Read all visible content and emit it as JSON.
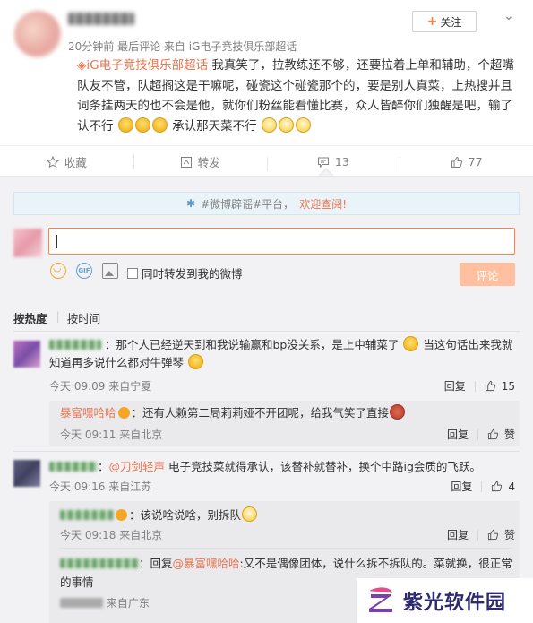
{
  "post": {
    "author_name": "",
    "meta_time": "20分钟前 最后评论",
    "meta_from_prefix": "来自",
    "meta_source": "iG电子竞技俱乐部超话",
    "follow_label": "关注",
    "topic": "iG电子竞技俱乐部超话",
    "text": "我真笑了，拉教练还不够，还要拉着上单和辅助，个超嘴队友不管，队超搁这是干嘛呢，碰瓷这个碰瓷那个的，要是别人真菜，上热搜并且词条挂两天的也不会是他，就你们粉丝能看懂比赛，众人皆醉你们独醒是吧，输了认不行",
    "text_tail": "承认那天菜不行"
  },
  "actions": {
    "favorite_label": "收藏",
    "repost_label": "转发",
    "comment_count": "13",
    "like_count": "77"
  },
  "notice": {
    "prefix": "#微博辟谣#平台，",
    "link": "欢迎查阅!"
  },
  "composer": {
    "checkbox_label": "同时转发到我的微博",
    "submit_label": "评论"
  },
  "sort": {
    "hot": "按热度",
    "time": "按时间"
  },
  "comments": [
    {
      "text": "：那个人已经逆天到和我说输赢和bp没关系，是上中辅菜了",
      "text2": "当这句话出来我就知道再多说什么都对牛弹琴",
      "time": "今天 09:09 来自宁夏",
      "reply": "回复",
      "likes": "15",
      "replies": [
        {
          "name": "暴富嘿哈哈",
          "text": "：还有人赖第二局莉莉娅不开团呢，给我气笑了直接",
          "time": "今天 09:11 来自北京",
          "reply": "回复",
          "like": "赞"
        }
      ]
    },
    {
      "mention": "@刀剑轻声",
      "text": " 电子竞技菜就得承认，该替补就替补，换个中路ig会质的飞跃。",
      "time": "今天 09:16 来自江苏",
      "reply": "回复",
      "likes": "4",
      "replies": [
        {
          "text": "：该说啥说啥，别拆队",
          "time": "今天 09:18 来自北京",
          "reply": "回复",
          "like": "赞"
        },
        {
          "text_prefix": "：回复",
          "mention": "@暴富嘿哈哈",
          "text": ":又不是偶像团体，说什么拆不拆队的。菜就换，很正常的事情",
          "time_suffix": "来自广东"
        }
      ]
    }
  ],
  "watermark": {
    "text": "紫光软件园"
  },
  "colors": {
    "accent": "#eb7350",
    "submit_disabled": "#ffc09f",
    "panel_bg": "#f2f2f5",
    "notice_bg": "#eaf4f8"
  }
}
